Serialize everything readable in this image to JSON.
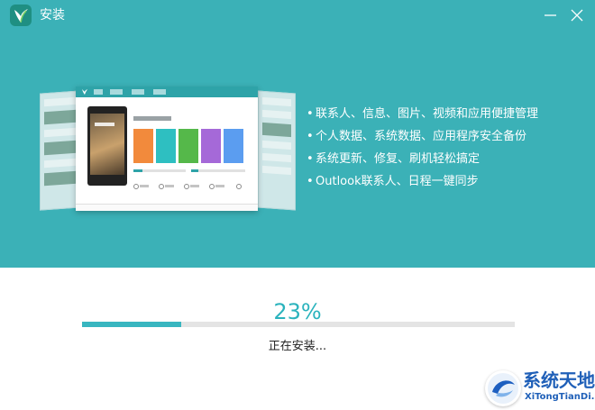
{
  "window": {
    "title": "安装",
    "minimize_icon": "minimize-icon",
    "close_icon": "close-icon",
    "logo_icon": "leaf-logo-icon"
  },
  "colors": {
    "header_bg": "#3bb1b7",
    "accent": "#38b6c0",
    "track": "#e4e4e4",
    "watermark_blue": "#2060b8"
  },
  "features": [
    "联系人、信息、图片、视频和应用便捷管理",
    "个人数据、系统数据、应用程序安全备份",
    "系统更新、修复、刷机轻松搞定",
    "Outlook联系人、日程一键同步"
  ],
  "feature_bullet": "•",
  "progress": {
    "label": "23%",
    "fraction": 0.23,
    "status": "正在安装..."
  },
  "watermark": {
    "name": "系统天地",
    "url": "XiTongTianDi.net"
  }
}
